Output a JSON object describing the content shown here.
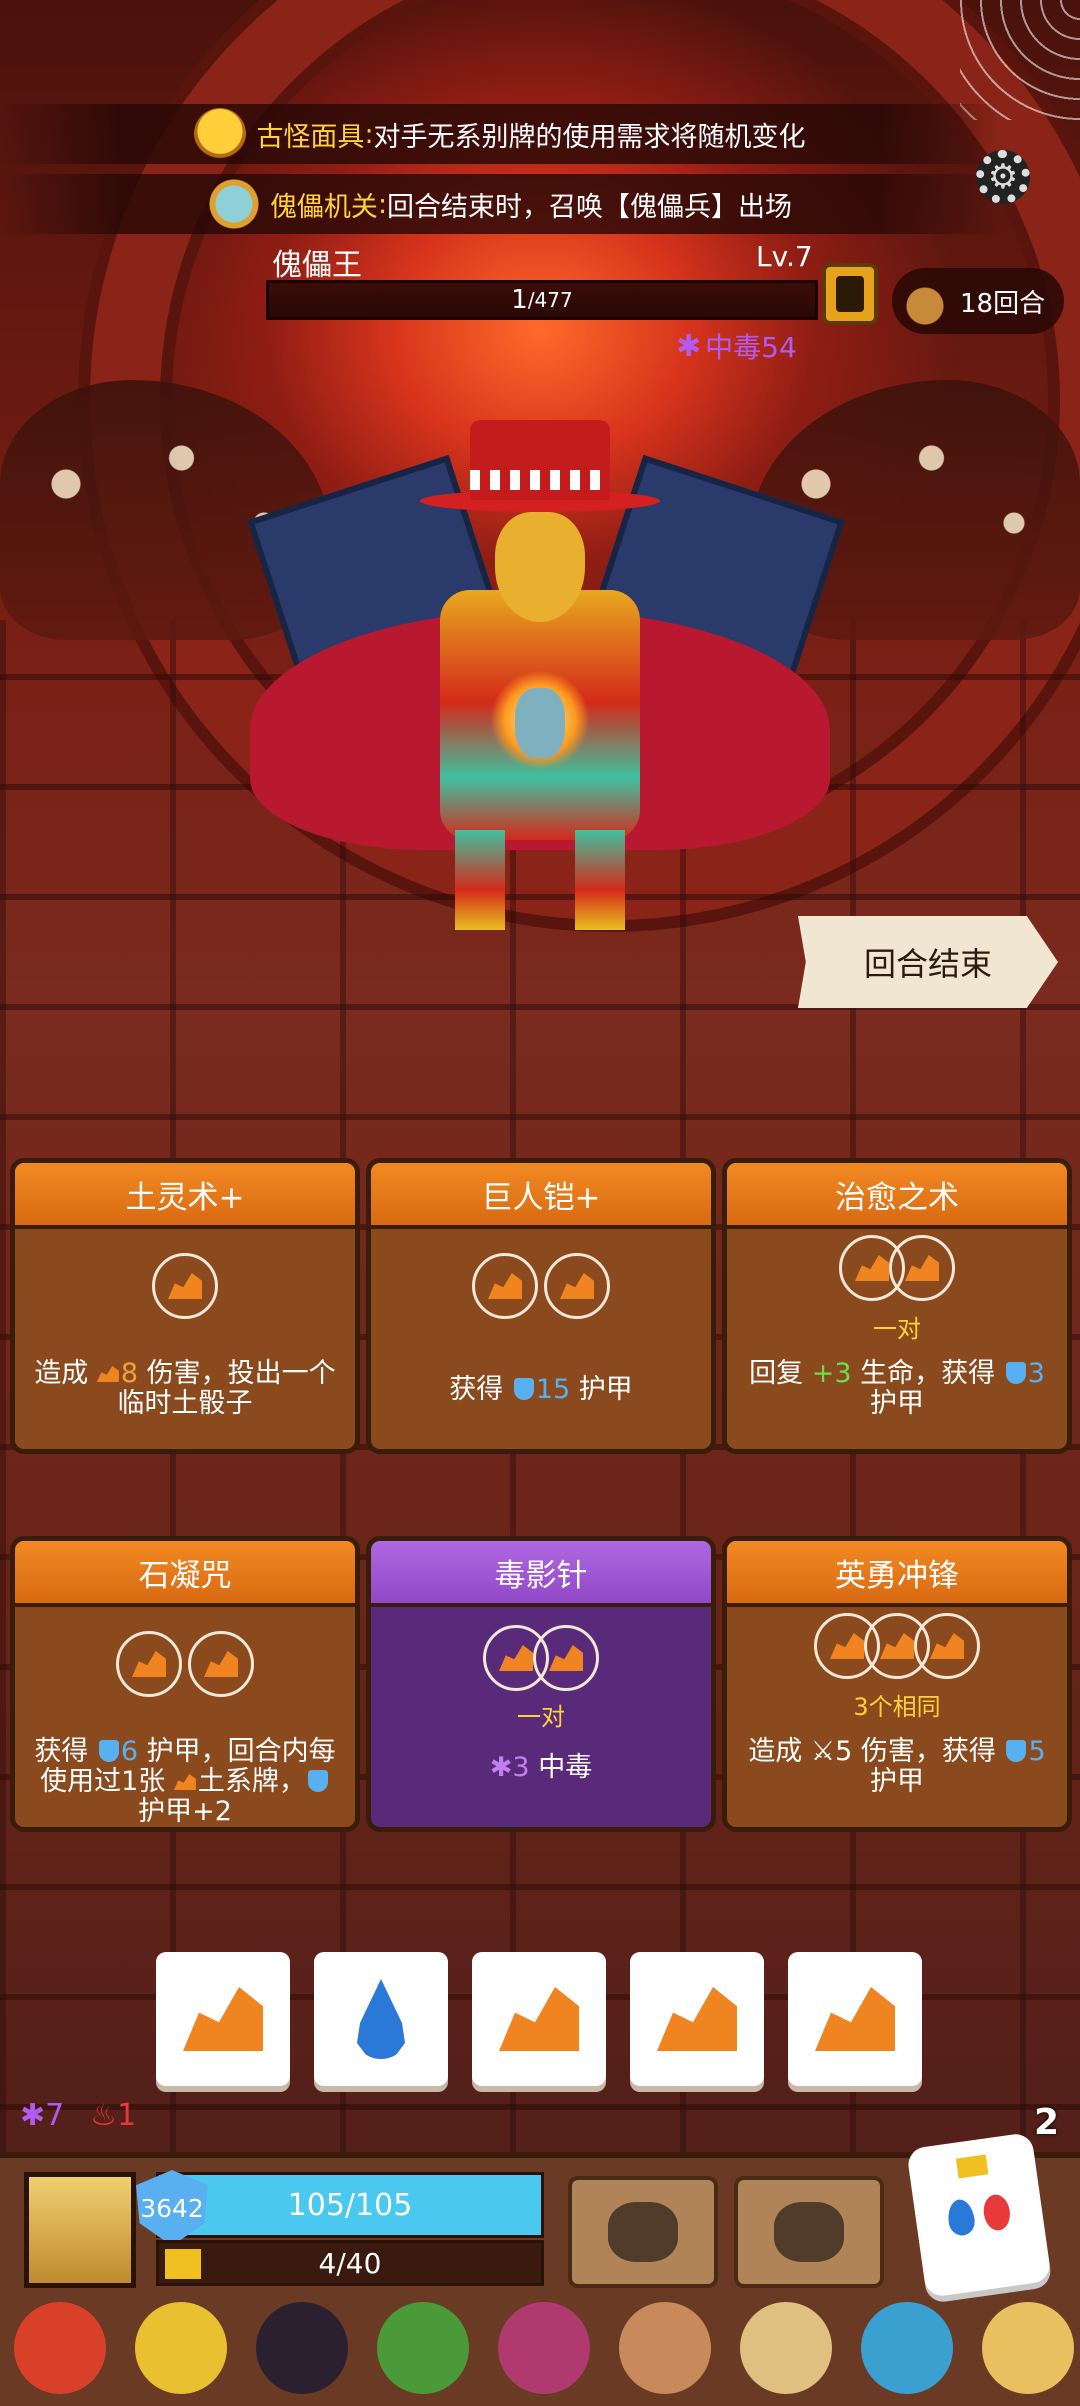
{
  "banners": [
    {
      "icon": "tiki-mask-icon",
      "name": "古怪面具",
      "sep": ":",
      "text": "对手无系别牌的使用需求将随机变化"
    },
    {
      "icon": "puppet-icon",
      "name": "傀儡机关",
      "sep": ":",
      "text": "回合结束时，召唤【傀儡兵】出场"
    }
  ],
  "boss": {
    "name": "傀儡王",
    "level": "Lv.7",
    "hp_current": "1",
    "hp_max": "/477",
    "status_poison": "中毒54",
    "round_label": "18回合"
  },
  "end_turn_label": "回合结束",
  "cards": [
    {
      "title": "土灵术+",
      "combo": "",
      "desc": [
        "造成 ",
        "8",
        " 伤害，投出一个临时土骰子"
      ]
    },
    {
      "title": "巨人铠+",
      "combo": "",
      "desc": [
        "获得 ",
        "15",
        " 护甲"
      ]
    },
    {
      "title": "治愈之术",
      "combo": "一对",
      "desc": [
        "回复 ",
        "+3",
        " 生命，获得 ",
        "3",
        " 护甲"
      ]
    },
    {
      "title": "石凝咒",
      "combo": "",
      "desc": [
        "获得 ",
        "6",
        " 护甲，回合内每使用过1张 ",
        "土系牌，",
        "护甲+2"
      ]
    },
    {
      "title": "毒影针",
      "combo": "一对",
      "desc": [
        "3",
        " 中毒"
      ]
    },
    {
      "title": "英勇冲锋",
      "combo": "3个相同",
      "desc": [
        "造成 ",
        "5",
        " 伤害，获得 ",
        "5",
        " 护甲"
      ]
    }
  ],
  "dice": [
    "earth",
    "water",
    "earth",
    "earth",
    "earth"
  ],
  "player": {
    "poison_stacks": "7",
    "fire_stacks": "1",
    "rolls_left": "2",
    "armor": "3642",
    "hp": "105/105",
    "xp": "4/40"
  },
  "icons": {
    "settings": "gear-icon",
    "boss_info": "bestiary-icon",
    "round": "hourglass-bag-icon",
    "skill_1": "fist-icon",
    "skill_2": "claw-icon",
    "reroll": "dice-icon"
  },
  "colors": {
    "card_orange": "#f28a22",
    "card_purple": "#b068e0",
    "poison": "#b25bf0",
    "hp_bar": "#4ac8f0"
  }
}
